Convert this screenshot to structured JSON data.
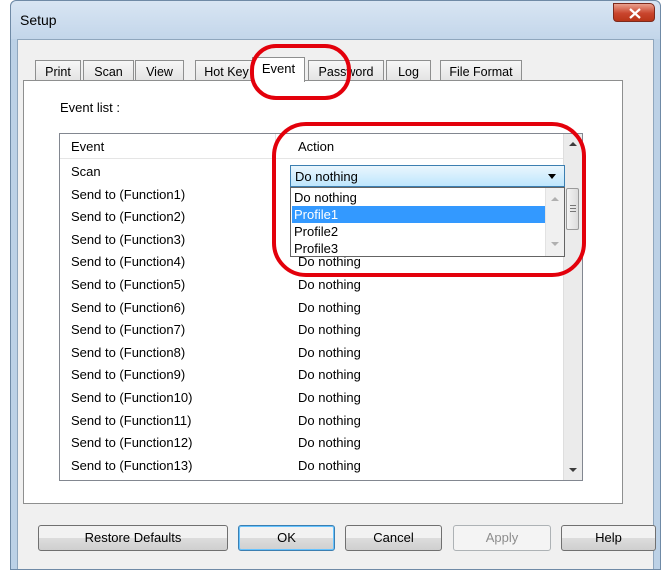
{
  "window": {
    "title": "Setup"
  },
  "tabs": [
    {
      "label": "Print"
    },
    {
      "label": "Scan"
    },
    {
      "label": "View"
    },
    {
      "label": "Hot Key"
    },
    {
      "label": "Event",
      "active": true
    },
    {
      "label": "Password"
    },
    {
      "label": "Log"
    },
    {
      "label": "File Format"
    }
  ],
  "event_tab": {
    "list_label": "Event list :",
    "columns": {
      "event": "Event",
      "action": "Action"
    },
    "rows": [
      {
        "event": "Scan",
        "action": "Do nothing"
      },
      {
        "event": "Send to (Function1)",
        "action": ""
      },
      {
        "event": "Send to (Function2)",
        "action": ""
      },
      {
        "event": "Send to (Function3)",
        "action": ""
      },
      {
        "event": "Send to (Function4)",
        "action": "Do nothing"
      },
      {
        "event": "Send to (Function5)",
        "action": "Do nothing"
      },
      {
        "event": "Send to (Function6)",
        "action": "Do nothing"
      },
      {
        "event": "Send to (Function7)",
        "action": "Do nothing"
      },
      {
        "event": "Send to (Function8)",
        "action": "Do nothing"
      },
      {
        "event": "Send to (Function9)",
        "action": "Do nothing"
      },
      {
        "event": "Send to (Function10)",
        "action": "Do nothing"
      },
      {
        "event": "Send to (Function11)",
        "action": "Do nothing"
      },
      {
        "event": "Send to (Function12)",
        "action": "Do nothing"
      },
      {
        "event": "Send to (Function13)",
        "action": "Do nothing"
      }
    ],
    "combo": {
      "value": "Do nothing",
      "options": [
        "Do nothing",
        "Profile1",
        "Profile2",
        "Profile3"
      ],
      "highlighted": "Profile1"
    }
  },
  "buttons": {
    "restore_defaults": "Restore Defaults",
    "ok": "OK",
    "cancel": "Cancel",
    "apply": "Apply",
    "help": "Help"
  },
  "colors": {
    "highlight_annotation": "#e3000b",
    "selection": "#3399ff"
  },
  "icons": {
    "close": "close-x-icon",
    "dropdown": "chevron-down-icon"
  }
}
